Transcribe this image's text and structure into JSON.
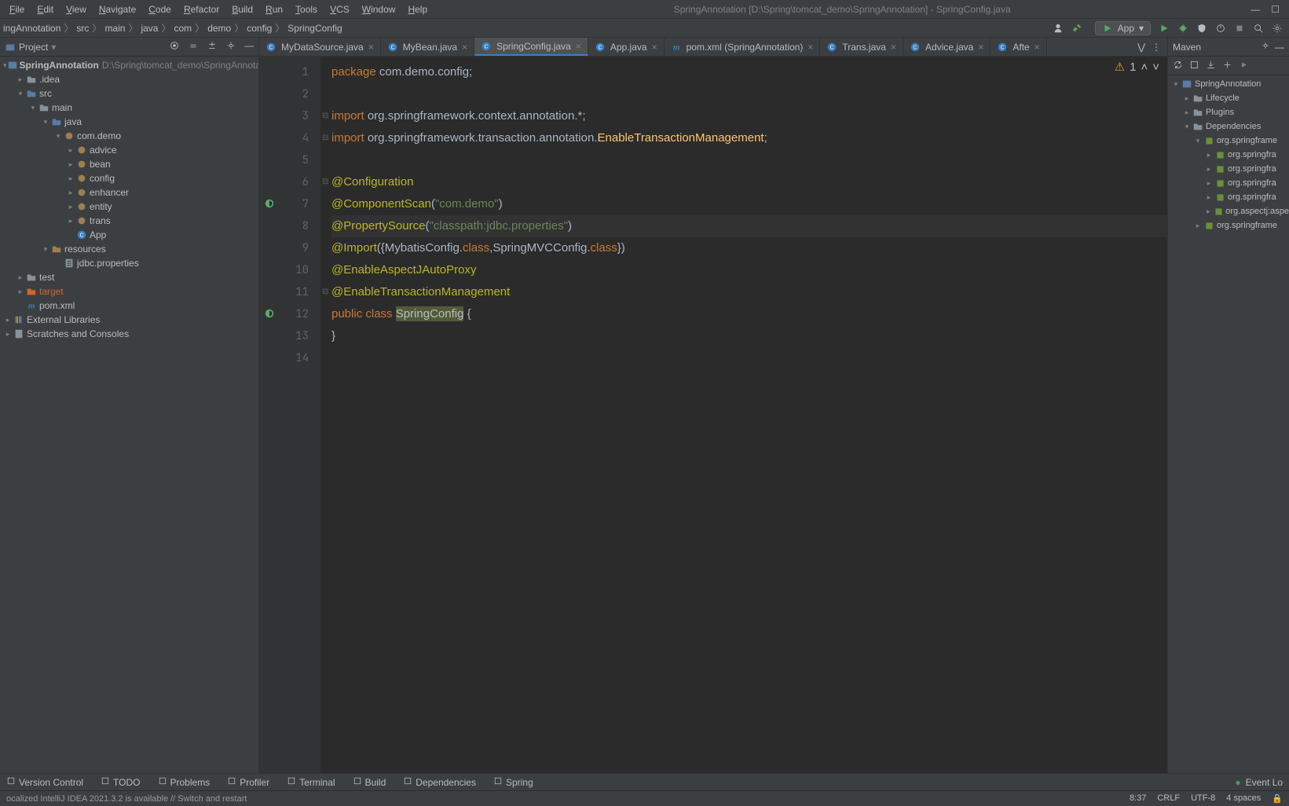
{
  "window": {
    "title": "SpringAnnotation [D:\\Spring\\tomcat_demo\\SpringAnnotation] - SpringConfig.java"
  },
  "menubar": {
    "items": [
      "File",
      "Edit",
      "View",
      "Navigate",
      "Code",
      "Refactor",
      "Build",
      "Run",
      "Tools",
      "VCS",
      "Window",
      "Help"
    ]
  },
  "breadcrumbs": {
    "items": [
      "ingAnnotation",
      "src",
      "main",
      "java",
      "com",
      "demo",
      "config",
      "SpringConfig"
    ]
  },
  "run_config": {
    "label": "App"
  },
  "project_panel": {
    "title": "Project"
  },
  "project_tree": [
    {
      "depth": 0,
      "arrow": "v",
      "icon": "module",
      "label": "SpringAnnotation",
      "hint": "D:\\Spring\\tomcat_demo\\SpringAnnotation",
      "mod": true
    },
    {
      "depth": 1,
      "arrow": ">",
      "icon": "folder",
      "label": ".idea"
    },
    {
      "depth": 1,
      "arrow": "v",
      "icon": "folder-blue",
      "label": "src"
    },
    {
      "depth": 2,
      "arrow": "v",
      "icon": "folder",
      "label": "main"
    },
    {
      "depth": 3,
      "arrow": "v",
      "icon": "folder-blue",
      "label": "java"
    },
    {
      "depth": 4,
      "arrow": "v",
      "icon": "package",
      "label": "com.demo"
    },
    {
      "depth": 5,
      "arrow": ">",
      "icon": "package",
      "label": "advice"
    },
    {
      "depth": 5,
      "arrow": ">",
      "icon": "package",
      "label": "bean"
    },
    {
      "depth": 5,
      "arrow": ">",
      "icon": "package",
      "label": "config"
    },
    {
      "depth": 5,
      "arrow": ">",
      "icon": "package",
      "label": "enhancer"
    },
    {
      "depth": 5,
      "arrow": ">",
      "icon": "package",
      "label": "entity"
    },
    {
      "depth": 5,
      "arrow": ">",
      "icon": "package",
      "label": "trans"
    },
    {
      "depth": 5,
      "arrow": "",
      "icon": "class",
      "label": "App"
    },
    {
      "depth": 3,
      "arrow": "v",
      "icon": "folder-res",
      "label": "resources"
    },
    {
      "depth": 4,
      "arrow": "",
      "icon": "props",
      "label": "jdbc.properties"
    },
    {
      "depth": 1,
      "arrow": ">",
      "icon": "folder",
      "label": "test"
    },
    {
      "depth": 1,
      "arrow": ">",
      "icon": "folder-orange",
      "label": "target",
      "cls": "target"
    },
    {
      "depth": 1,
      "arrow": "",
      "icon": "maven",
      "label": "pom.xml"
    },
    {
      "depth": 0,
      "arrow": ">",
      "icon": "lib",
      "label": "External Libraries"
    },
    {
      "depth": 0,
      "arrow": ">",
      "icon": "scratch",
      "label": "Scratches and Consoles"
    }
  ],
  "tabs": [
    {
      "label": "MyDataSource.java",
      "icon": "class",
      "active": false
    },
    {
      "label": "MyBean.java",
      "icon": "class",
      "active": false
    },
    {
      "label": "SpringConfig.java",
      "icon": "class",
      "active": true
    },
    {
      "label": "App.java",
      "icon": "class",
      "active": false
    },
    {
      "label": "pom.xml (SpringAnnotation)",
      "icon": "maven",
      "active": false
    },
    {
      "label": "Trans.java",
      "icon": "class",
      "active": false
    },
    {
      "label": "Advice.java",
      "icon": "class",
      "active": false
    },
    {
      "label": "Afte",
      "icon": "class",
      "active": false
    }
  ],
  "editor": {
    "warnings": "1",
    "lines": [
      {
        "n": 1,
        "segs": [
          {
            "t": "package ",
            "c": "kw"
          },
          {
            "t": "com.demo.config",
            "c": "pkg"
          },
          {
            "t": ";",
            "c": "id"
          }
        ]
      },
      {
        "n": 2,
        "segs": []
      },
      {
        "n": 3,
        "segs": [
          {
            "t": "import ",
            "c": "kw"
          },
          {
            "t": "org.springframework.context.annotation.*",
            "c": "pkg"
          },
          {
            "t": ";",
            "c": "id"
          }
        ],
        "fold": true
      },
      {
        "n": 4,
        "segs": [
          {
            "t": "import ",
            "c": "kw"
          },
          {
            "t": "org.springframework.transaction.annotation.",
            "c": "pkg"
          },
          {
            "t": "EnableTransactionManagement",
            "c": "c-yellow"
          },
          {
            "t": ";",
            "c": "id"
          }
        ],
        "fold": true
      },
      {
        "n": 5,
        "segs": []
      },
      {
        "n": 6,
        "segs": [
          {
            "t": "@Configuration",
            "c": "ann"
          }
        ],
        "fold": true
      },
      {
        "n": 7,
        "segs": [
          {
            "t": "@ComponentScan",
            "c": "ann"
          },
          {
            "t": "(",
            "c": "id"
          },
          {
            "t": "\"com.demo\"",
            "c": "str"
          },
          {
            "t": ")",
            "c": "id"
          }
        ],
        "gutter": "spring"
      },
      {
        "n": 8,
        "segs": [
          {
            "t": "@PropertySource",
            "c": "ann"
          },
          {
            "t": "(",
            "c": "id"
          },
          {
            "t": "\"classpath:jdbc.properties\"",
            "c": "str"
          },
          {
            "t": ")",
            "c": "id"
          }
        ],
        "hl": true
      },
      {
        "n": 9,
        "segs": [
          {
            "t": "@Import",
            "c": "ann"
          },
          {
            "t": "({MybatisConfig.",
            "c": "id"
          },
          {
            "t": "class",
            "c": "kw"
          },
          {
            "t": ",SpringMVCConfig.",
            "c": "id"
          },
          {
            "t": "class",
            "c": "kw"
          },
          {
            "t": "})",
            "c": "id"
          }
        ]
      },
      {
        "n": 10,
        "segs": [
          {
            "t": "@EnableAspectJAutoProxy",
            "c": "ann"
          }
        ]
      },
      {
        "n": 11,
        "segs": [
          {
            "t": "@EnableTransactionManagement",
            "c": "ann"
          }
        ],
        "fold": true
      },
      {
        "n": 12,
        "segs": [
          {
            "t": "public class ",
            "c": "kw"
          },
          {
            "t": "SpringConfig",
            "c": "hlname"
          },
          {
            "t": " {",
            "c": "id"
          }
        ],
        "gutter": "spring"
      },
      {
        "n": 13,
        "segs": [
          {
            "t": "}",
            "c": "id"
          }
        ]
      },
      {
        "n": 14,
        "segs": []
      }
    ]
  },
  "maven": {
    "title": "Maven",
    "tree": [
      {
        "depth": 0,
        "arrow": "v",
        "icon": "module",
        "label": "SpringAnnotation"
      },
      {
        "depth": 1,
        "arrow": ">",
        "icon": "folder",
        "label": "Lifecycle"
      },
      {
        "depth": 1,
        "arrow": ">",
        "icon": "folder",
        "label": "Plugins"
      },
      {
        "depth": 1,
        "arrow": "v",
        "icon": "folder",
        "label": "Dependencies"
      },
      {
        "depth": 2,
        "arrow": "v",
        "icon": "jar",
        "label": "org.springframe"
      },
      {
        "depth": 3,
        "arrow": ">",
        "icon": "jar",
        "label": "org.springfra"
      },
      {
        "depth": 3,
        "arrow": ">",
        "icon": "jar",
        "label": "org.springfra"
      },
      {
        "depth": 3,
        "arrow": ">",
        "icon": "jar",
        "label": "org.springfra"
      },
      {
        "depth": 3,
        "arrow": ">",
        "icon": "jar",
        "label": "org.springfra"
      },
      {
        "depth": 3,
        "arrow": ">",
        "icon": "jar",
        "label": "org.aspectj:aspe"
      },
      {
        "depth": 2,
        "arrow": ">",
        "icon": "jar",
        "label": "org.springframe"
      }
    ]
  },
  "bottom_tools": {
    "items": [
      {
        "icon": "vcs",
        "label": "Version Control"
      },
      {
        "icon": "todo",
        "label": "TODO"
      },
      {
        "icon": "problems",
        "label": "Problems"
      },
      {
        "icon": "profiler",
        "label": "Profiler"
      },
      {
        "icon": "terminal",
        "label": "Terminal"
      },
      {
        "icon": "build",
        "label": "Build"
      },
      {
        "icon": "deps",
        "label": "Dependencies"
      },
      {
        "icon": "spring",
        "label": "Spring"
      }
    ],
    "event_log": "Event Lo"
  },
  "statusbar": {
    "msg": "ocalized IntelliJ IDEA 2021.3.2 is available // Switch and restart",
    "pos": "8:37",
    "eol": "CRLF",
    "enc": "UTF-8",
    "indent": "4 spaces"
  }
}
